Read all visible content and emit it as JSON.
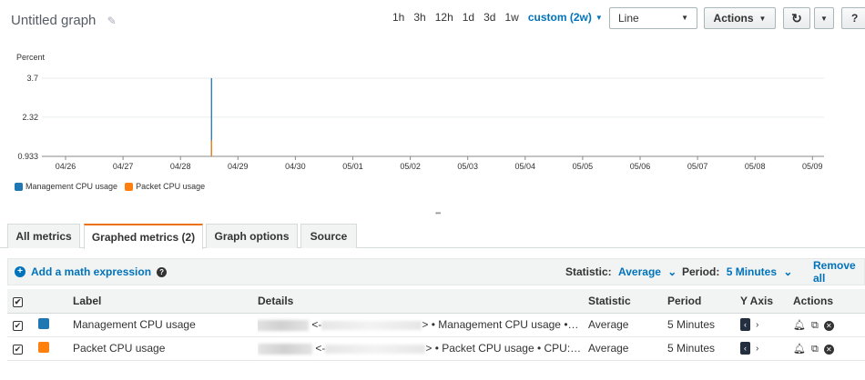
{
  "header": {
    "title": "Untitled graph",
    "time_ranges": [
      "1h",
      "3h",
      "12h",
      "1d",
      "3d",
      "1w"
    ],
    "custom_range": "custom (2w)",
    "chart_type_select": "Line",
    "actions_button": "Actions"
  },
  "chart_data": {
    "type": "line",
    "ylabel": "Percent",
    "y_ticks": [
      "3.7",
      "2.32",
      "0.933"
    ],
    "ylim": [
      0.933,
      3.7
    ],
    "x_ticks": [
      "04/26",
      "04/27",
      "04/28",
      "04/29",
      "04/30",
      "05/01",
      "05/02",
      "05/03",
      "05/04",
      "05/05",
      "05/06",
      "05/07",
      "05/08",
      "05/09"
    ],
    "series": [
      {
        "name": "Management CPU usage",
        "color": "#1f77b4",
        "spike_at": "04/28-04/29",
        "values_peak": 3.7
      },
      {
        "name": "Packet CPU usage",
        "color": "#ff7f0e",
        "spike_at": "04/28-04/29",
        "values_peak": 1.5
      }
    ],
    "grid": true,
    "legend_position": "bottom-left"
  },
  "tabs": [
    "All metrics",
    "Graphed metrics (2)",
    "Graph options",
    "Source"
  ],
  "active_tab": "Graphed metrics (2)",
  "math_bar": {
    "add_label": "Add a math expression",
    "statistic_label": "Statistic:",
    "statistic_value": "Average",
    "period_label": "Period:",
    "period_value": "5 Minutes",
    "remove_all": "Remove all"
  },
  "table": {
    "headers": [
      "Label",
      "Details",
      "Statistic",
      "Period",
      "Y Axis",
      "Actions"
    ],
    "rows": [
      {
        "label": "Management CPU usage",
        "color": "#1f77b4",
        "details_prefix": "<-",
        "details": "> • Management CPU usage •…",
        "statistic": "Average",
        "period": "5 Minutes"
      },
      {
        "label": "Packet CPU usage",
        "color": "#ff7f0e",
        "details_prefix": "<-",
        "details": "> • Packet CPU usage • CPU:…",
        "statistic": "Average",
        "period": "5 Minutes"
      }
    ]
  }
}
